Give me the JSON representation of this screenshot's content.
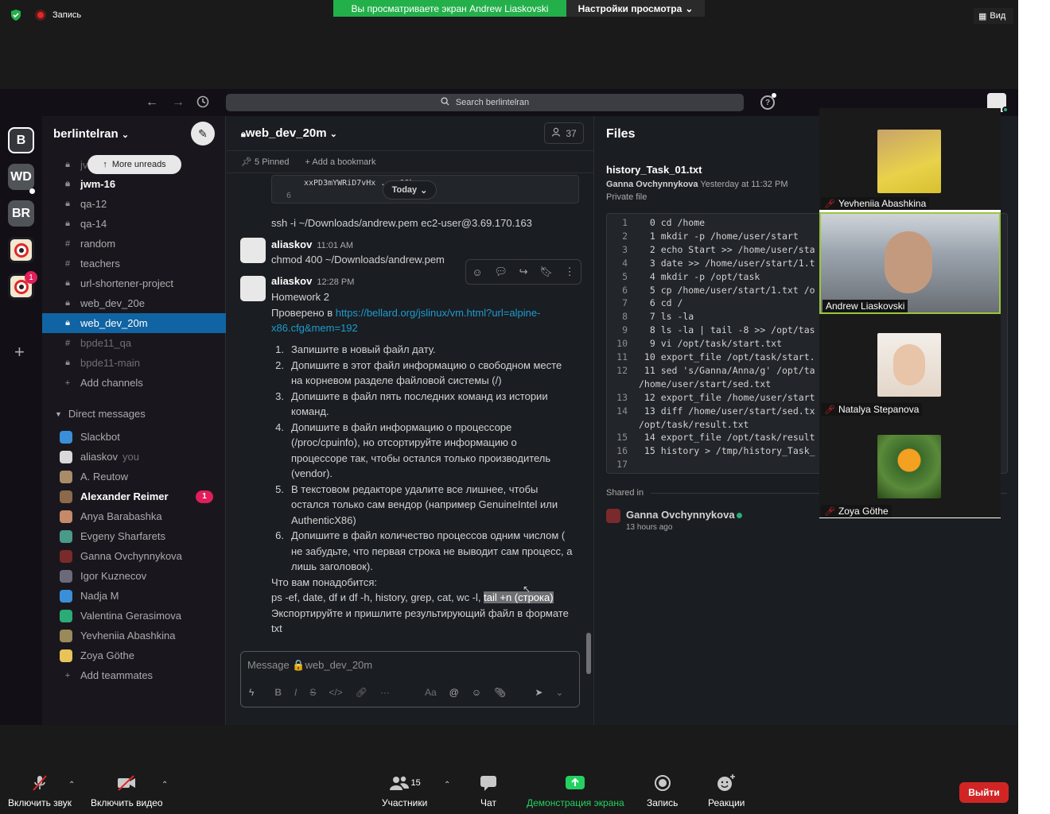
{
  "zoom": {
    "record_label": "Запись",
    "banner": "Вы просматриваете экран Andrew Liaskovski",
    "view_settings": "Настройки просмотра",
    "view_label": "Вид",
    "footer": {
      "audio": "Включить звук",
      "video": "Включить видео",
      "participants": "Участники",
      "participants_count": "15",
      "chat": "Чат",
      "share": "Демонстрация экрана",
      "record": "Запись",
      "reactions": "Реакции",
      "leave": "Выйти"
    },
    "gallery": [
      {
        "name": "Yevheniia Abashkina",
        "muted": true
      },
      {
        "name": "Andrew Liaskovski",
        "muted": false
      },
      {
        "name": "Natalya Stepanova",
        "muted": true
      },
      {
        "name": "Zoya Göthe",
        "muted": true
      }
    ]
  },
  "slack": {
    "search_placeholder": "Search berlintelran",
    "workspaces": [
      {
        "label": "B"
      },
      {
        "label": "WD"
      },
      {
        "label": "BR"
      },
      {
        "label": ""
      },
      {
        "label": "",
        "badge": "1"
      }
    ],
    "workspace_name": "berlintelran",
    "more_unreads": "More unreads",
    "channels": [
      {
        "icon": "lock",
        "name": "jv",
        "style": "dim"
      },
      {
        "icon": "lock",
        "name": "jwm-16",
        "style": "bold"
      },
      {
        "icon": "lock",
        "name": "qa-12",
        "style": ""
      },
      {
        "icon": "lock",
        "name": "qa-14",
        "style": ""
      },
      {
        "icon": "hash",
        "name": "random",
        "style": ""
      },
      {
        "icon": "hash",
        "name": "teachers",
        "style": ""
      },
      {
        "icon": "lock",
        "name": "url-shortener-project",
        "style": ""
      },
      {
        "icon": "lock",
        "name": "web_dev_20e",
        "style": ""
      },
      {
        "icon": "lock",
        "name": "web_dev_20m",
        "style": "active"
      },
      {
        "icon": "hash",
        "name": "bpde11_qa",
        "style": "dim"
      },
      {
        "icon": "lock",
        "name": "bpde11-main",
        "style": "dim"
      }
    ],
    "add_channels": "Add channels",
    "direct_messages_label": "Direct messages",
    "dms": [
      {
        "name": "Slackbot",
        "suffix": "",
        "bold": false,
        "badge": ""
      },
      {
        "name": "aliaskov",
        "suffix": "you",
        "bold": false,
        "badge": ""
      },
      {
        "name": "A. Reutow",
        "suffix": "",
        "bold": false,
        "badge": ""
      },
      {
        "name": "Alexander Reimer",
        "suffix": "",
        "bold": true,
        "badge": "1"
      },
      {
        "name": "Anya Barabashka",
        "suffix": "",
        "bold": false,
        "badge": ""
      },
      {
        "name": "Evgeny Sharfarets",
        "suffix": "",
        "bold": false,
        "badge": ""
      },
      {
        "name": "Ganna Ovchynnykova",
        "suffix": "",
        "bold": false,
        "badge": ""
      },
      {
        "name": "Igor Kuznecov",
        "suffix": "",
        "bold": false,
        "badge": ""
      },
      {
        "name": "Nadja M",
        "suffix": "",
        "bold": false,
        "badge": ""
      },
      {
        "name": "Valentina Gerasimova",
        "suffix": "",
        "bold": false,
        "badge": ""
      },
      {
        "name": "Yevheniia Abashkina",
        "suffix": "",
        "bold": false,
        "badge": ""
      },
      {
        "name": "Zoya Göthe",
        "suffix": "",
        "bold": false,
        "badge": ""
      }
    ],
    "add_teammates": "Add teammates",
    "channel": {
      "name": "web_dev_20m",
      "member_count": "37",
      "pinned": "5 Pinned",
      "add_bookmark": "Add a bookmark",
      "code_snippet_line": "xxPD3mYWRiD7vHx ... 0Qbq",
      "code_snippet_ln": "6",
      "today": "Today",
      "ssh_line": "ssh -i ~/Downloads/andrew.pem ec2-user@3.69.170.163",
      "msg1": {
        "user": "aliaskov",
        "time": "11:01 AM",
        "text": "chmod 400 ~/Downloads/andrew.pem"
      },
      "msg2": {
        "user": "aliaskov",
        "time": "12:28 PM",
        "title": "Homework 2",
        "checked": "Проверено в ",
        "link1": "https://bellard.org/jslinux/vm.html?url=alpine-",
        "link2": "x86.cfg&mem=192",
        "items": [
          {
            "num": "1.",
            "lines": [
              "Запишите в новый файл дату."
            ]
          },
          {
            "num": "2.",
            "lines": [
              "Допишите в этот файл информацию о свободном месте",
              "на корневом разделе файловой системы (/)"
            ]
          },
          {
            "num": "3.",
            "lines": [
              "Допишите в файл пять последних команд из истории",
              "команд."
            ]
          },
          {
            "num": "4.",
            "lines": [
              "Допишите в файл информацию о процессоре",
              "(/proc/cpuinfo), но отсортируйте информацию о",
              "процессоре так, чтобы остался только производитель",
              "(vendor)."
            ]
          },
          {
            "num": "5.",
            "lines": [
              "В текстовом редакторе удалите все лишнее, чтобы",
              "остался только сам вендор (например GenuineIntel или",
              "AuthenticX86)"
            ]
          },
          {
            "num": "6.",
            "lines": [
              "Допишите в файл количество процессов одним числом (",
              "не забудьте, что первая строка не выводит сам процесс, а",
              "лишь заголовок)."
            ]
          }
        ],
        "need": "Что вам понадобится:",
        "tools_plain": "ps -ef, date, df и df -h, history, grep, cat, wc -l, ",
        "tools_hl": "tail +n (строка)",
        "export1": "Экспортируйте и пришлите результирующий файл в формате",
        "export2": "txt"
      },
      "composer_placeholder": "Message 🔒web_dev_20m"
    },
    "files": {
      "title": "Files",
      "file_name": "history_Task_01.txt",
      "author": "Ganna Ovchynnykova",
      "when": "Yesterday at 11:32 PM",
      "privacy": "Private file",
      "lines": [
        {
          "n": "1",
          "t": "  0 cd /home"
        },
        {
          "n": "2",
          "t": "  1 mkdir -p /home/user/start"
        },
        {
          "n": "3",
          "t": "  2 echo Start >> /home/user/sta"
        },
        {
          "n": "4",
          "t": "  3 date >> /home/user/start/1.t"
        },
        {
          "n": "5",
          "t": "  4 mkdir -p /opt/task"
        },
        {
          "n": "6",
          "t": "  5 cp /home/user/start/1.txt /o"
        },
        {
          "n": "7",
          "t": "  6 cd /"
        },
        {
          "n": "8",
          "t": "  7 ls -la"
        },
        {
          "n": "9",
          "t": "  8 ls -la | tail -8 >> /opt/tas"
        },
        {
          "n": "10",
          "t": "  9 vi /opt/task/start.txt"
        },
        {
          "n": "11",
          "t": " 10 export_file /opt/task/start."
        },
        {
          "n": "12",
          "t": " 11 sed 's/Ganna/Anna/g' /opt/ta"
        },
        {
          "n": "",
          "t": "/home/user/start/sed.txt"
        },
        {
          "n": "13",
          "t": " 12 export_file /home/user/start"
        },
        {
          "n": "14",
          "t": " 13 diff /home/user/start/sed.tx"
        },
        {
          "n": "",
          "t": "/opt/task/result.txt"
        },
        {
          "n": "15",
          "t": " 14 export_file /opt/task/result"
        },
        {
          "n": "16",
          "t": " 15 history > /tmp/history_Task_"
        },
        {
          "n": "17",
          "t": ""
        }
      ],
      "shared_in": "Shared in",
      "shared_by": "Ganna Ovchynnykova",
      "shared_time": "13 hours ago"
    }
  }
}
